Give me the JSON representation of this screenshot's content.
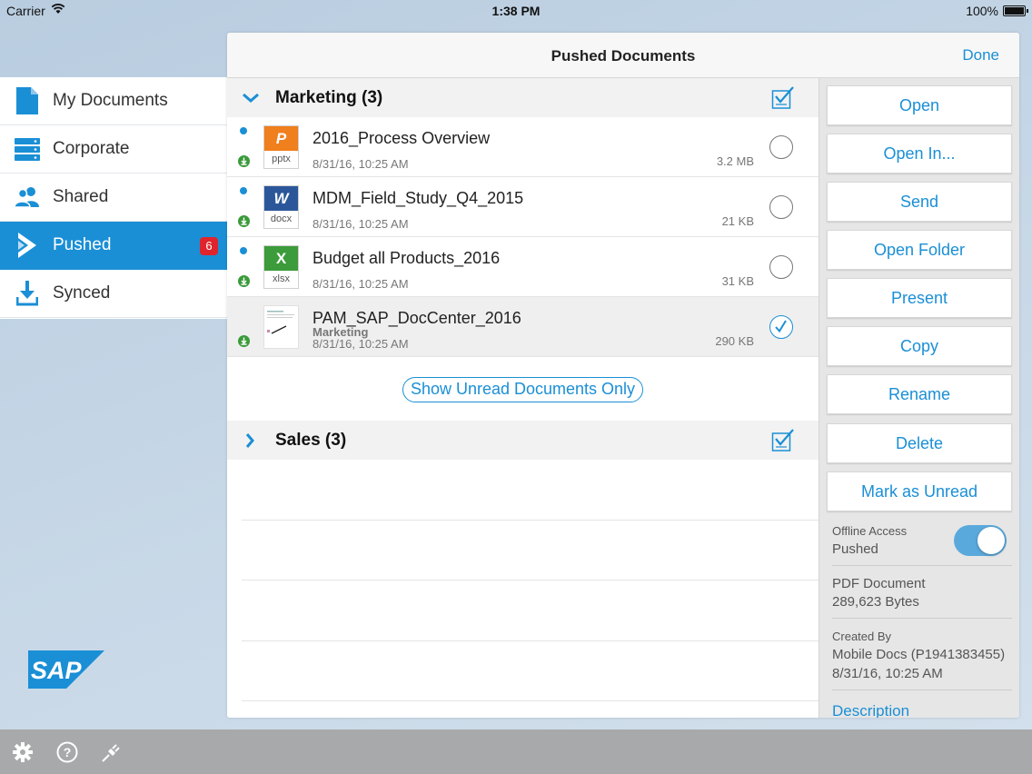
{
  "status_bar": {
    "carrier": "Carrier",
    "time": "1:38 PM",
    "battery": "100%"
  },
  "sidebar": {
    "items": [
      {
        "label": "My Documents",
        "icon": "document-icon"
      },
      {
        "label": "Corporate",
        "icon": "server-icon"
      },
      {
        "label": "Shared",
        "icon": "people-icon"
      },
      {
        "label": "Pushed",
        "icon": "pushed-icon",
        "badge": "6",
        "active": true
      },
      {
        "label": "Synced",
        "icon": "download-icon"
      }
    ]
  },
  "brand": {
    "logo_text": "SAP",
    "accent": "#1a8fd6",
    "badge_color": "#e0242c"
  },
  "panel": {
    "title": "Pushed Documents",
    "done_label": "Done"
  },
  "groups": [
    {
      "title": "Marketing (3)",
      "expanded": true,
      "documents": [
        {
          "name": "2016_Process Overview",
          "ext": "pptx",
          "type_letter": "P",
          "type_color": "#f07f1d",
          "date": "8/31/16, 10:25 AM",
          "size": "3.2 MB",
          "unread": true,
          "selected": false
        },
        {
          "name": "MDM_Field_Study_Q4_2015",
          "ext": "docx",
          "type_letter": "W",
          "type_color": "#2b579a",
          "date": "8/31/16, 10:25 AM",
          "size": "21 KB",
          "unread": true,
          "selected": false
        },
        {
          "name": "Budget all Products_2016",
          "ext": "xlsx",
          "type_letter": "X",
          "type_color": "#3c9b3a",
          "date": "8/31/16, 10:25 AM",
          "size": "31 KB",
          "unread": true,
          "selected": false
        },
        {
          "name": "PAM_SAP_DocCenter_2016",
          "subtitle": "Marketing",
          "ext": "",
          "type_letter": "",
          "date": "8/31/16, 10:25 AM",
          "size": "290 KB",
          "unread": false,
          "selected": true
        }
      ]
    },
    {
      "title": "Sales (3)",
      "expanded": false
    }
  ],
  "show_unread_label": "Show Unread Documents Only",
  "actions": [
    "Open",
    "Open In...",
    "Send",
    "Open Folder",
    "Present",
    "Copy",
    "Rename",
    "Delete",
    "Mark as Unread"
  ],
  "details": {
    "offline_label": "Offline Access",
    "offline_value": "Pushed",
    "offline_enabled": true,
    "doc_type": "PDF Document",
    "doc_size": "289,623 Bytes",
    "created_by_label": "Created By",
    "created_by": "Mobile Docs (P1941383455)",
    "created_date": "8/31/16, 10:25 AM",
    "description_label": "Description"
  },
  "bottom_bar": {
    "icons": [
      "gear-icon",
      "help-icon",
      "plug-icon"
    ]
  }
}
